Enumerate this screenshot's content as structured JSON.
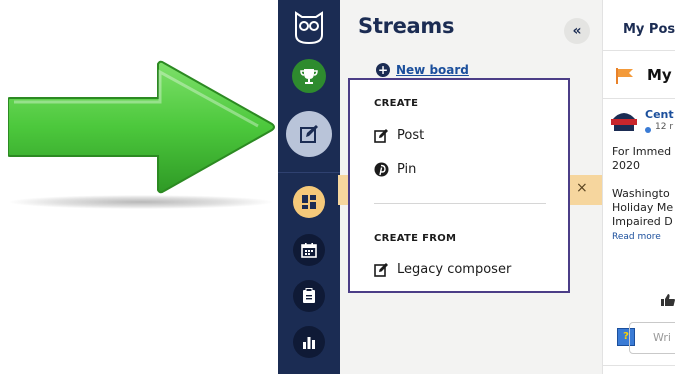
{
  "sidebar": {
    "items": [
      {
        "name": "owl-logo-icon"
      },
      {
        "name": "trophy-icon",
        "color": "#2e8b2e"
      },
      {
        "name": "compose-icon",
        "active": true
      },
      {
        "name": "dashboard-icon",
        "color": "#f5c97a"
      },
      {
        "name": "calendar-icon"
      },
      {
        "name": "clipboard-icon"
      },
      {
        "name": "bar-chart-icon"
      }
    ],
    "background": "#1b2c53"
  },
  "streams": {
    "title": "Streams",
    "collapse_label": "«",
    "new_board_label": "New board",
    "close_label": "×"
  },
  "create_menu": {
    "create_heading": "CREATE",
    "items": [
      {
        "label": "Post",
        "icon": "compose-icon"
      },
      {
        "label": "Pin",
        "icon": "pinterest-icon"
      }
    ],
    "create_from_heading": "CREATE FROM",
    "legacy_label": "Legacy composer",
    "border_color": "#4b3d87"
  },
  "right_pane": {
    "title": "My Pos",
    "board_name": "My I",
    "post": {
      "author": "Cent",
      "time": "12 r",
      "lines": [
        "For Immed",
        "2020",
        "",
        "Washingto",
        "Holiday Me",
        "Impaired D"
      ],
      "read_more": "Read more"
    },
    "comment_placeholder": "Wri"
  },
  "colors": {
    "arrow_green": "#4cc83c",
    "accent_orange": "#f6d69e",
    "link_blue": "#1b4f9c"
  }
}
